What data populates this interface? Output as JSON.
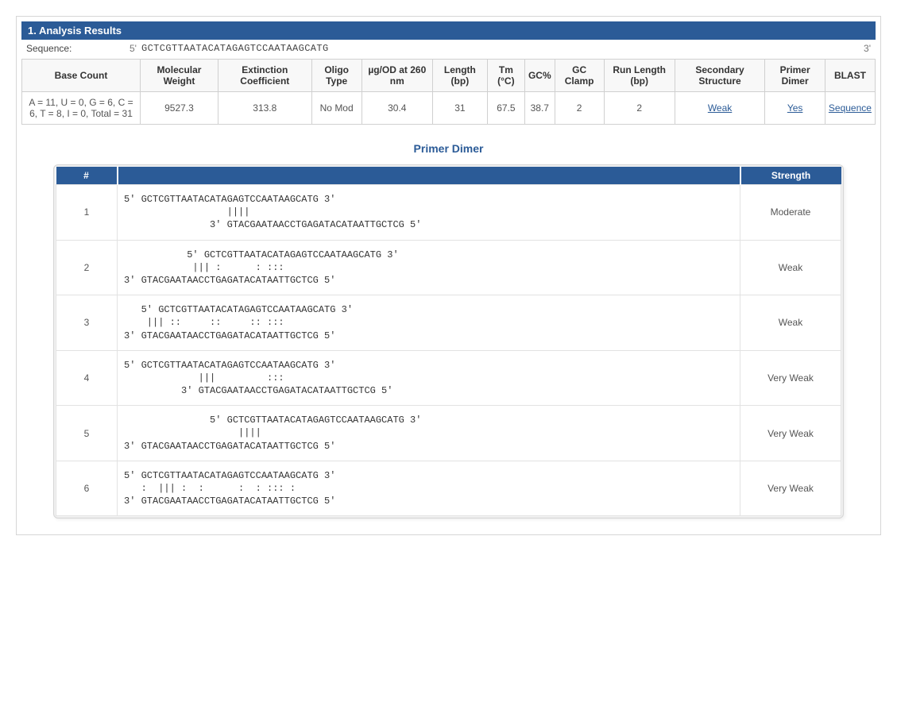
{
  "section": {
    "title": "1. Analysis Results"
  },
  "sequence": {
    "label": "Sequence:",
    "prefix": "5'",
    "value": "GCTCGTTAATACATAGAGTCCAATAAGCATG",
    "suffix": "3'"
  },
  "results": {
    "headers": [
      "Base Count",
      "Molecular Weight",
      "Extinction Coefficient",
      "Oligo Type",
      "µg/OD at 260 nm",
      "Length (bp)",
      "Tm (°C)",
      "GC%",
      "GC Clamp",
      "Run Length (bp)",
      "Secondary Structure",
      "Primer Dimer",
      "BLAST"
    ],
    "row": {
      "base_count": "A = 11, U = 0, G = 6, C = 6, T = 8, I = 0, Total = 31",
      "mw": "9527.3",
      "ext_coeff": "313.8",
      "oligo_type": "No Mod",
      "ug_od": "30.4",
      "length": "31",
      "tm": "67.5",
      "gc_pct": "38.7",
      "gc_clamp": "2",
      "run_len": "2",
      "sec_struct": "Weak",
      "primer_dimer": "Yes",
      "blast": "Sequence"
    }
  },
  "dimer_section": {
    "title": "Primer Dimer",
    "headers": {
      "num": "#",
      "strength": "Strength"
    },
    "rows": [
      {
        "num": "1",
        "strength": "Moderate",
        "align": "5' GCTCGTTAATACATAGAGTCCAATAAGCATG 3'\n                  ||||\n               3' GTACGAATAACCTGAGATACATAATTGCTCG 5'"
      },
      {
        "num": "2",
        "strength": "Weak",
        "align": "           5' GCTCGTTAATACATAGAGTCCAATAAGCATG 3'\n            ||| :      : :::\n3' GTACGAATAACCTGAGATACATAATTGCTCG 5'"
      },
      {
        "num": "3",
        "strength": "Weak",
        "align": "   5' GCTCGTTAATACATAGAGTCCAATAAGCATG 3'\n    ||| ::     ::     :: :::\n3' GTACGAATAACCTGAGATACATAATTGCTCG 5'"
      },
      {
        "num": "4",
        "strength": "Very Weak",
        "align": "5' GCTCGTTAATACATAGAGTCCAATAAGCATG 3'\n             |||         :::\n          3' GTACGAATAACCTGAGATACATAATTGCTCG 5'"
      },
      {
        "num": "5",
        "strength": "Very Weak",
        "align": "               5' GCTCGTTAATACATAGAGTCCAATAAGCATG 3'\n                    ||||\n3' GTACGAATAACCTGAGATACATAATTGCTCG 5'"
      },
      {
        "num": "6",
        "strength": "Very Weak",
        "align": "5' GCTCGTTAATACATAGAGTCCAATAAGCATG 3'\n   :  ||| :  :      :  : ::: :\n3' GTACGAATAACCTGAGATACATAATTGCTCG 5'"
      }
    ]
  }
}
